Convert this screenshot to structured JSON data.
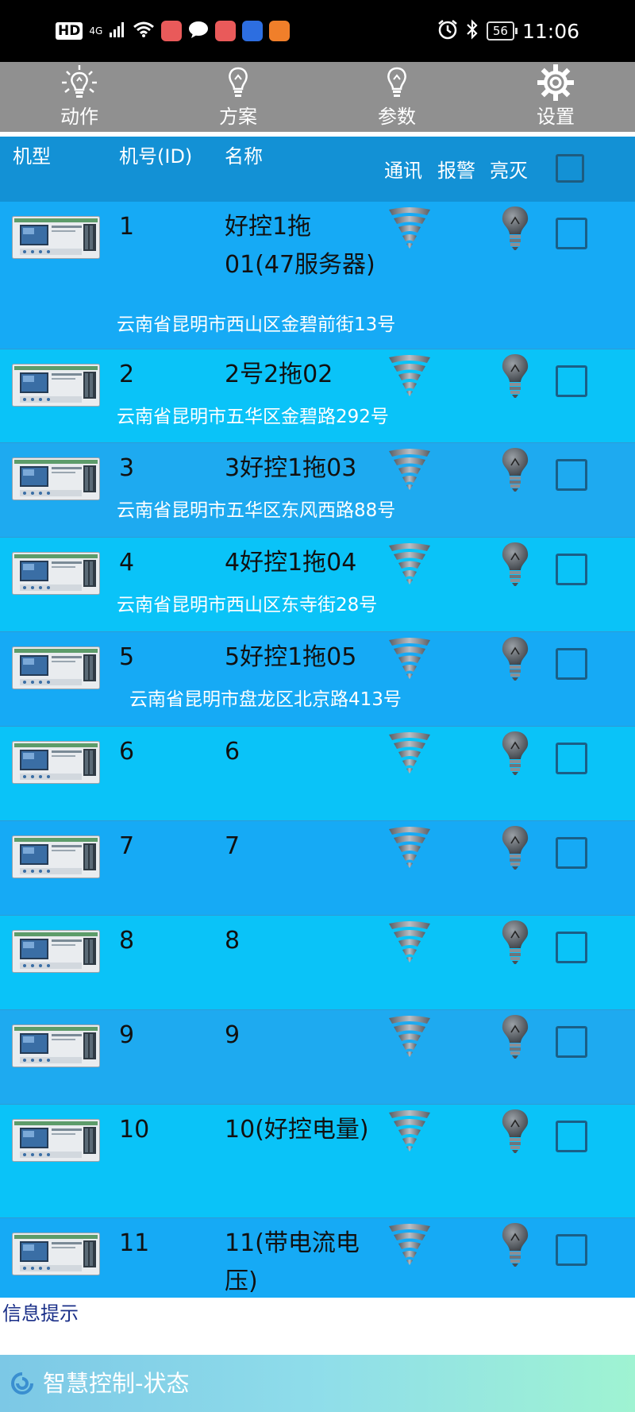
{
  "status_bar": {
    "network_badge": "HD",
    "network_type": "4G",
    "battery": "56",
    "time": "11:06"
  },
  "nav": [
    {
      "label": "动作",
      "icon": "light-bulb-rays-icon"
    },
    {
      "label": "方案",
      "icon": "light-bulb-icon"
    },
    {
      "label": "参数",
      "icon": "light-bulb-icon"
    },
    {
      "label": "设置",
      "icon": "gear-icon"
    }
  ],
  "table_header": {
    "model": "机型",
    "id": "机号(ID)",
    "name": "名称",
    "comm": "通讯",
    "alarm": "报警",
    "onoff": "亮灭"
  },
  "rows": [
    {
      "id": "1",
      "name": "好控1拖01(47服务器)",
      "address": "云南省昆明市西山区金碧前街13号",
      "checked": false
    },
    {
      "id": "2",
      "name": "2号2拖02",
      "address": "云南省昆明市五华区金碧路292号",
      "checked": false
    },
    {
      "id": "3",
      "name": "3好控1拖03",
      "address": "云南省昆明市五华区东风西路88号",
      "checked": false
    },
    {
      "id": "4",
      "name": "4好控1拖04",
      "address": "云南省昆明市西山区东寺街28号",
      "checked": false
    },
    {
      "id": "5",
      "name": "5好控1拖05",
      "address": "云南省昆明市盘龙区北京路413号",
      "checked": false
    },
    {
      "id": "6",
      "name": "6",
      "address": "",
      "checked": false
    },
    {
      "id": "7",
      "name": "7",
      "address": "",
      "checked": false
    },
    {
      "id": "8",
      "name": "8",
      "address": "",
      "checked": false
    },
    {
      "id": "9",
      "name": "9",
      "address": "",
      "checked": false
    },
    {
      "id": "10",
      "name": "10(好控电量)",
      "address": "",
      "checked": false
    },
    {
      "id": "11",
      "name": "11(带电流电压)",
      "address": "",
      "checked": false
    }
  ],
  "info_label": "信息提示",
  "footer_title": "智慧控制-状态"
}
